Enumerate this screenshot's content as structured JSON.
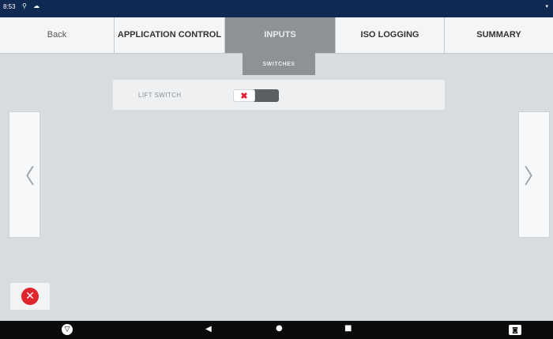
{
  "statusbar": {
    "time": "8:53",
    "icons": "⚲ ☁",
    "signal": "▾"
  },
  "tabs": {
    "back": "Back",
    "application_control": "APPLICATION CONTROL",
    "inputs": "INPUTS",
    "iso_logging": "ISO LOGGING",
    "summary": "SUMMARY"
  },
  "subtab": {
    "label": "SWITCHES"
  },
  "row": {
    "label": "LIFT SWITCH",
    "toggle_off_symbol": "✖",
    "state": "off"
  },
  "arrows": {
    "left": "〈",
    "right": "〉"
  },
  "close": {
    "symbol": "✕"
  },
  "navbar": {
    "logo": "▽",
    "back": "◀",
    "home": "●",
    "recents": "■",
    "camera": "◙"
  },
  "colors": {
    "active_tab": "#8d9296",
    "statusbar": "#0f2a52",
    "close": "#e0242e"
  }
}
